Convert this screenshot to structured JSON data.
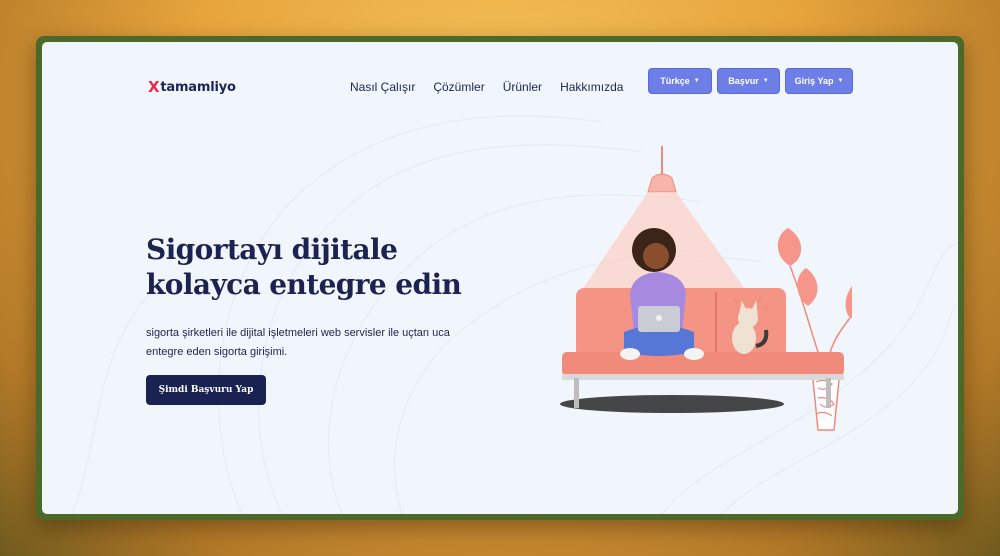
{
  "brand": {
    "logo_mark": "X",
    "logo_text": "tamamliyo"
  },
  "nav": {
    "links": [
      "Nasıl Çalışır",
      "Çözümler",
      "Ürünler",
      "Hakkımızda"
    ],
    "buttons": [
      {
        "label": "Türkçe",
        "caret": "▼"
      },
      {
        "label": "Başvur",
        "caret": "▼"
      },
      {
        "label": "Giriş Yap",
        "caret": "▼"
      }
    ]
  },
  "hero": {
    "title_line1": "Sigortayı dijitale",
    "title_line2": "kolayca entegre edin",
    "description_line1": "sigorta şirketleri ile dijital işletmeleri web servisler ile uçtan uca",
    "description_line2": "entegre eden sigorta girişimi.",
    "cta_label": "Şimdi Başvuru Yap"
  },
  "colors": {
    "primary_button": "#6d7fe6",
    "dark_navy": "#192250",
    "logo_accent": "#e8294a",
    "page_bg": "#f1f6fd",
    "sofa": "#f08a7a"
  },
  "illustration": {
    "icon": "person-on-sofa-with-laptop-illustration"
  }
}
